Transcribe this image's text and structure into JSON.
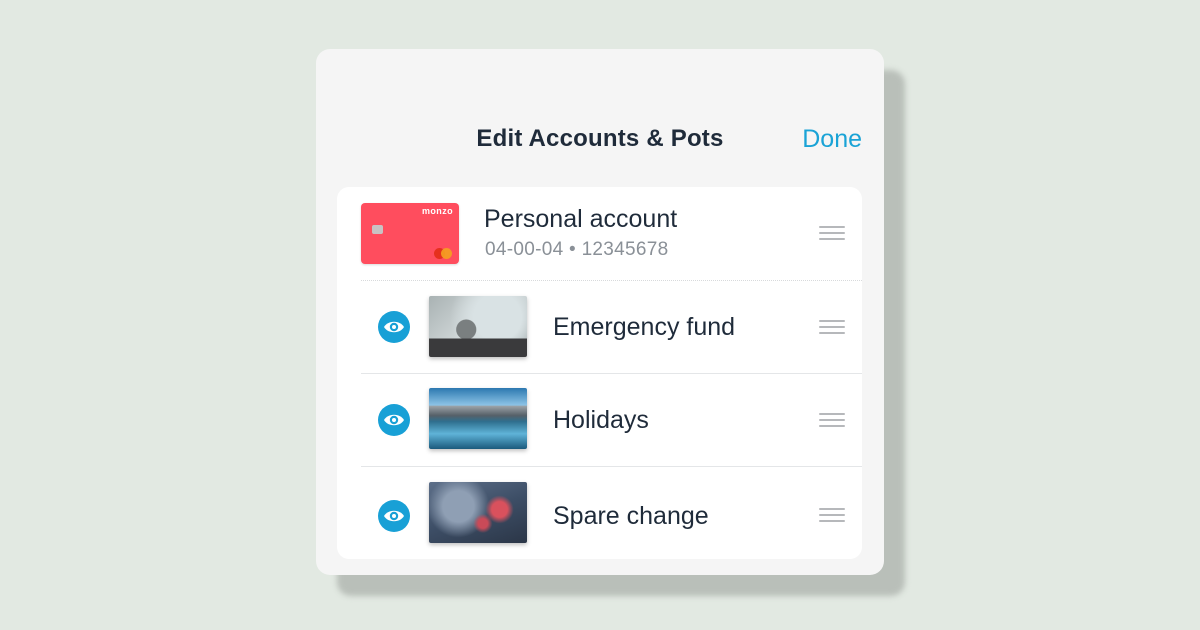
{
  "header": {
    "title": "Edit Accounts & Pots",
    "done_label": "Done"
  },
  "account": {
    "name": "Personal account",
    "sort_code_and_number": "04-00-04 • 12345678",
    "card_brand": "monzo",
    "card_color": "#ff4d5e"
  },
  "pots": [
    {
      "name": "Emergency fund",
      "visible": true,
      "visibility_icon": "eye-icon"
    },
    {
      "name": "Holidays",
      "visible": true,
      "visibility_icon": "eye-icon"
    },
    {
      "name": "Spare change",
      "visible": true,
      "visibility_icon": "eye-icon"
    }
  ],
  "colors": {
    "accent": "#1aa3d6",
    "background": "#e2e9e2",
    "sheet": "#f5f5f5",
    "text_primary": "#1f2b3a",
    "text_secondary": "#8a9097"
  }
}
